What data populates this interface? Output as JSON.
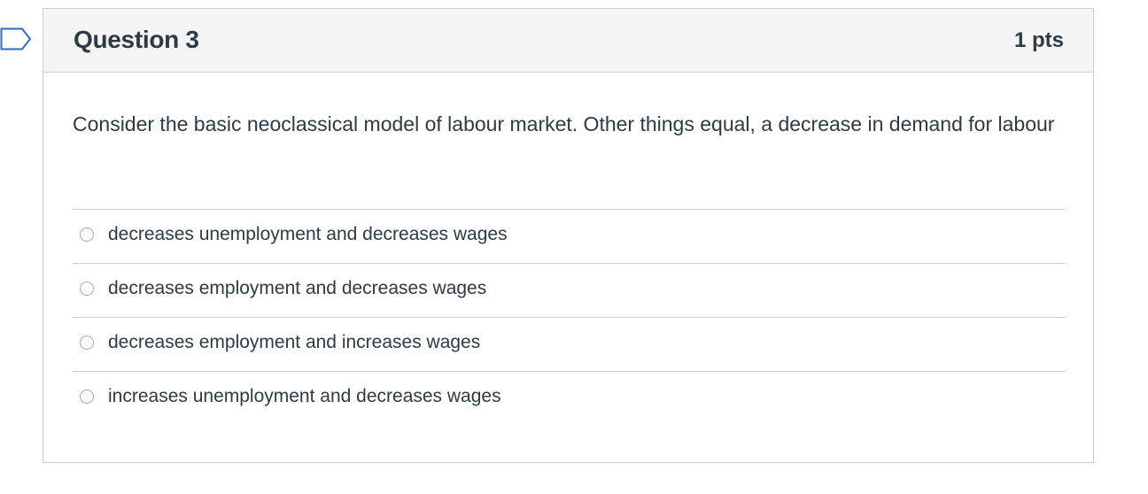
{
  "question": {
    "title": "Question 3",
    "points": "1 pts",
    "text": "Consider the basic neoclassical model of labour market. Other things equal, a decrease in demand for labour",
    "flag_icon": "bookmark-flag-icon",
    "answers": [
      {
        "label": "decreases unemployment and decreases wages",
        "selected": false
      },
      {
        "label": "decreases employment and decreases wages",
        "selected": false
      },
      {
        "label": "decreases employment and increases wages",
        "selected": false
      },
      {
        "label": "increases unemployment and decreases wages",
        "selected": false
      }
    ]
  }
}
